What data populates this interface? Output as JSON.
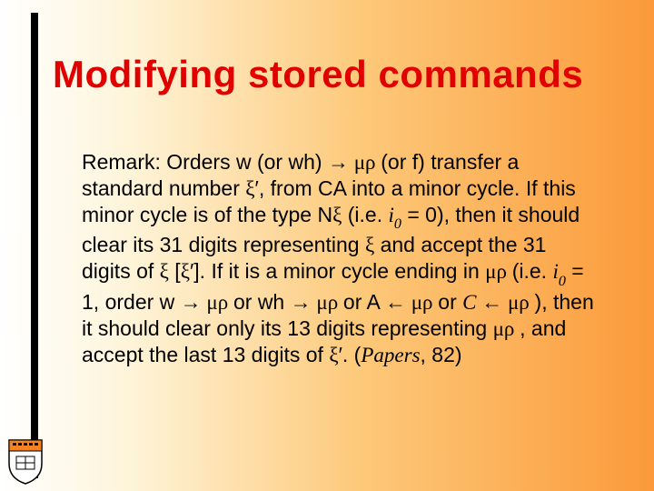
{
  "title": "Modifying stored commands",
  "body": {
    "p1a": "Remark:  Orders w (or wh) ",
    "arrow_r": "→",
    "mr": " μρ ",
    "p1b": "(or f) transfer a standard number ",
    "xi": "ξ",
    "prime": "′",
    "p1c": ", from CA into a minor cycle.  If this minor cycle is of the type N",
    "p1d": " (i.e. ",
    "i0": "i",
    "zero": "0",
    "p1e": " = 0), then it should clear its 31 digits representing ",
    "p1f": " and accept the 31 digits of ",
    "lb": " [",
    "rb": "].  ",
    "p1g": "If it is a minor cycle ending in ",
    "p1h": " (i.e. ",
    "p1i": " = 1, order w ",
    "or": " or ",
    "wh": "wh ",
    "A": "A ",
    "arrow_l": "←",
    "C": " C ",
    "p1j": "), then it should clear only its 13 digits representing ",
    "p1k": ", and accept the last 13 digits of ",
    "cite_open": ". (",
    "cite": "Papers",
    "cite_close": ", 82)"
  }
}
